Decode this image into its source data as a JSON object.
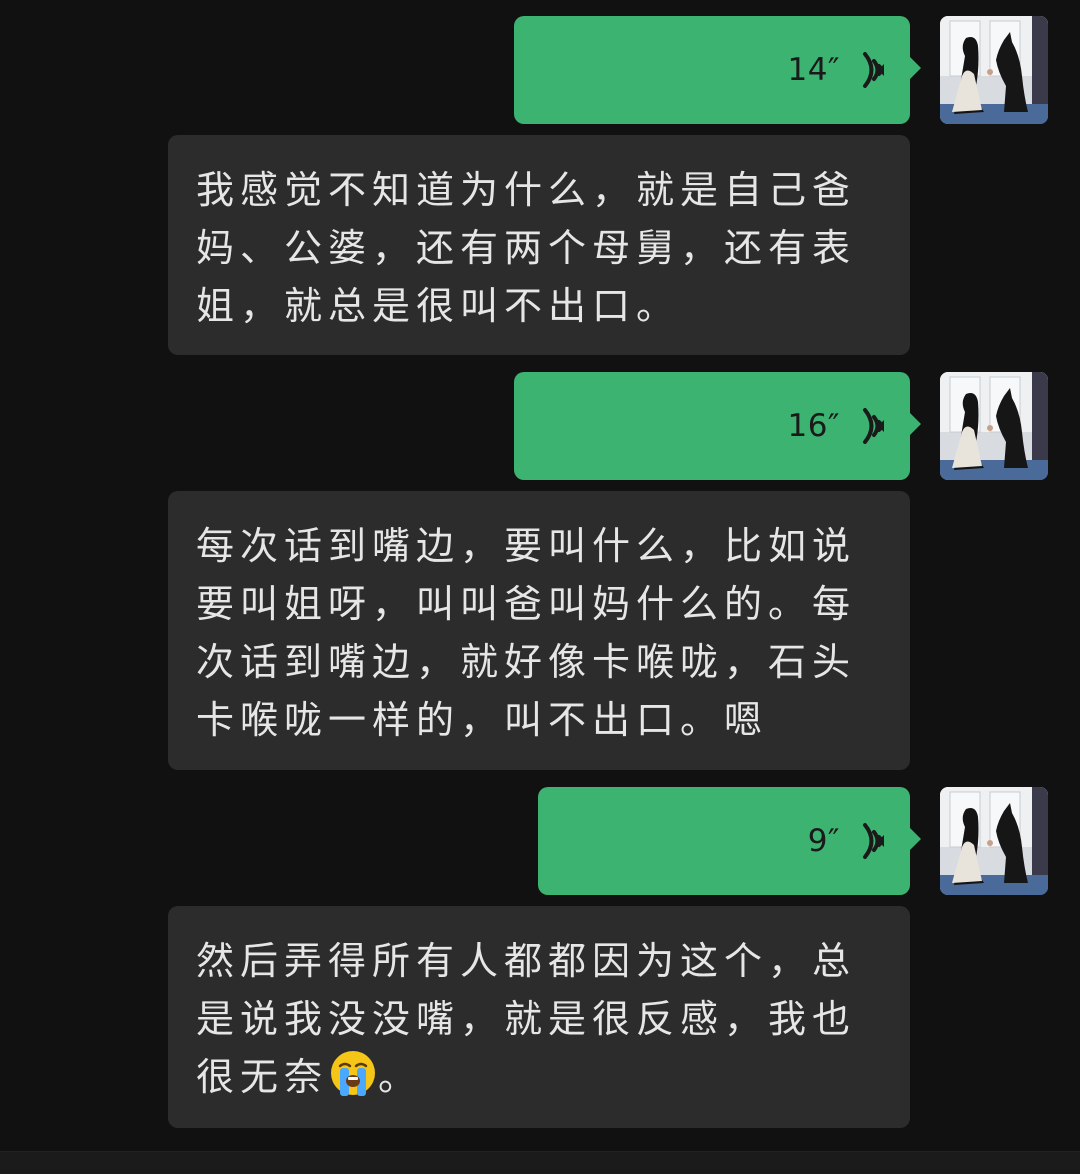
{
  "messages": [
    {
      "type": "voice",
      "sender": "self",
      "duration": "14″"
    },
    {
      "type": "text",
      "sender": "other",
      "text": "我感觉不知道为什么，就是自己爸妈、公婆，还有两个母舅，还有表姐，就总是很叫不出口。"
    },
    {
      "type": "voice",
      "sender": "self",
      "duration": "16″"
    },
    {
      "type": "text",
      "sender": "other",
      "text": "每次话到嘴边，要叫什么，比如说要叫姐呀，叫叫爸叫妈什么的。每次话到嘴边，就好像卡喉咙，石头卡喉咙一样的，叫不出口。嗯"
    },
    {
      "type": "voice",
      "sender": "self",
      "duration": "9″"
    },
    {
      "type": "text",
      "sender": "other",
      "text_before_emoji": "然后弄得所有人都都因为这个，总是说我没没嘴，就是很反感，我也很无奈",
      "emoji": "loudly-crying-face",
      "text_after_emoji": "。"
    }
  ],
  "colors": {
    "background": "#111111",
    "voice_bubble": "#3cb371",
    "text_bubble": "#2c2c2c",
    "text": "#e6e6e6"
  },
  "icons": {
    "voice": "sound-wave-icon",
    "avatar": "woman-with-dog-avatar"
  }
}
